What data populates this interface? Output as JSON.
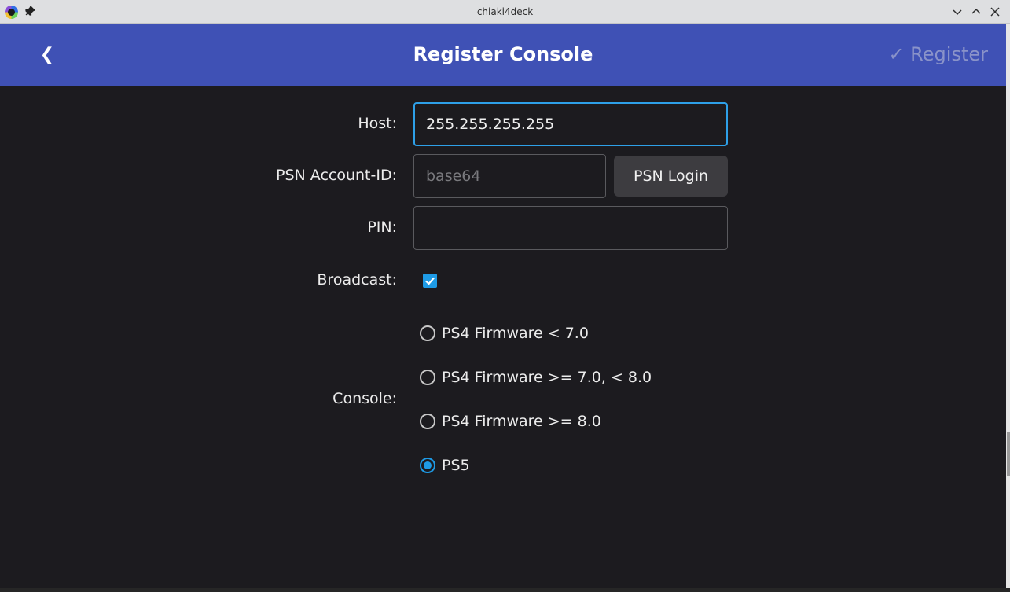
{
  "window": {
    "title": "chiaki4deck",
    "icons": {
      "app": "chiaki-app-icon",
      "pin": "pin-icon",
      "minimize": "chevron-down-icon",
      "maximize": "chevron-up-icon",
      "close": "close-icon"
    }
  },
  "header": {
    "back_label": "❮",
    "title": "Register Console",
    "register_label": "✓ Register",
    "background": "#3f51b5"
  },
  "form": {
    "host_label": "Host:",
    "host_value": "255.255.255.255",
    "psn_label": "PSN Account-ID:",
    "psn_placeholder": "base64",
    "psn_login_label": "PSN Login",
    "pin_label": "PIN:",
    "pin_value": "",
    "broadcast_label": "Broadcast:",
    "broadcast_checked": true,
    "console_label": "Console:",
    "console_options": [
      {
        "label": "PS4 Firmware < 7.0",
        "checked": false
      },
      {
        "label": "PS4 Firmware >= 7.0, < 8.0",
        "checked": false
      },
      {
        "label": "PS4 Firmware >= 8.0",
        "checked": false
      },
      {
        "label": "PS5",
        "checked": true
      }
    ]
  },
  "colors": {
    "accent": "#1e9be6",
    "background": "#1c1b1f",
    "button": "#3d3c40"
  }
}
